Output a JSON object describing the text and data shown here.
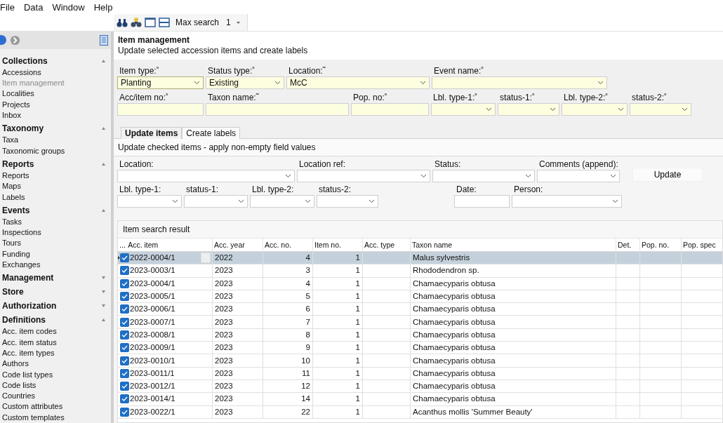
{
  "menu": [
    "File",
    "Data",
    "Window",
    "Help"
  ],
  "toolbar": {
    "max_search_label": "Max search",
    "max_search_value": "1"
  },
  "sidebar": [
    {
      "title": "Collections",
      "expanded": true,
      "items": [
        {
          "label": "Accessions",
          "selected": false
        },
        {
          "label": "Item management",
          "selected": true
        },
        {
          "label": "Localities",
          "selected": false
        },
        {
          "label": "Projects",
          "selected": false
        },
        {
          "label": "Inbox",
          "selected": false
        }
      ]
    },
    {
      "title": "Taxonomy",
      "expanded": true,
      "items": [
        {
          "label": "Taxa",
          "selected": false
        },
        {
          "label": "Taxonomic groups",
          "selected": false
        }
      ]
    },
    {
      "title": "Reports",
      "expanded": true,
      "items": [
        {
          "label": "Reports",
          "selected": false
        },
        {
          "label": "Maps",
          "selected": false
        },
        {
          "label": "Labels",
          "selected": false
        }
      ]
    },
    {
      "title": "Events",
      "expanded": true,
      "items": [
        {
          "label": "Tasks",
          "selected": false
        },
        {
          "label": "Inspections",
          "selected": false
        },
        {
          "label": "Tours",
          "selected": false
        },
        {
          "label": "Funding",
          "selected": false
        },
        {
          "label": "Exchanges",
          "selected": false
        }
      ]
    },
    {
      "title": "Management",
      "expanded": false
    },
    {
      "title": "Store",
      "expanded": false
    },
    {
      "title": "Authorization",
      "expanded": false
    },
    {
      "title": "Definitions",
      "expanded": true,
      "items": [
        {
          "label": "Acc. item codes",
          "selected": false
        },
        {
          "label": "Acc. item status",
          "selected": false
        },
        {
          "label": "Acc. item types",
          "selected": false
        },
        {
          "label": "Authors",
          "selected": false
        },
        {
          "label": "Code list types",
          "selected": false
        },
        {
          "label": "Code lists",
          "selected": false
        },
        {
          "label": "Countries",
          "selected": false
        },
        {
          "label": "Custom attributes",
          "selected": false
        },
        {
          "label": "Custom templates",
          "selected": false
        }
      ]
    }
  ],
  "page": {
    "title": "Item management",
    "subtitle": "Update selected accession items and create labels"
  },
  "filters": [
    {
      "fields": [
        {
          "label": "Item type:˚",
          "kind": "combo",
          "value": "Planting",
          "focused": true
        },
        {
          "label": "Status type:˚",
          "kind": "combo",
          "value": "Existing"
        },
        {
          "label": "Location:˜",
          "kind": "combo",
          "value": "McC"
        },
        {
          "label": "Event name:˚",
          "kind": "combo"
        }
      ]
    },
    {
      "fields": [
        {
          "label": "Acc/item no:˚",
          "kind": "text"
        },
        {
          "label": "Taxon name:˜",
          "kind": "text"
        },
        {
          "label": "Pop. no:˚",
          "kind": "text"
        },
        {
          "label": "Lbl. type-1:˚",
          "kind": "combo"
        },
        {
          "label": "status-1:˚",
          "kind": "combo"
        },
        {
          "label": "Lbl. type-2:˚",
          "kind": "combo"
        },
        {
          "label": "status-2:˚",
          "kind": "combo"
        }
      ]
    }
  ],
  "tabs": [
    {
      "label": "Update items",
      "selected": true
    },
    {
      "label": "Create labels",
      "selected": false
    }
  ],
  "update": {
    "description": "Update checked items - apply non-empty field values",
    "rows": [
      {
        "fields": [
          {
            "label": "Location:",
            "kind": "combo"
          },
          {
            "label": "Location ref:",
            "kind": "combo"
          },
          {
            "label": "Status:",
            "kind": "combo"
          },
          {
            "label": "Comments (append):",
            "kind": "combo"
          }
        ]
      },
      {
        "fields": [
          {
            "label": "Lbl. type-1:",
            "kind": "combo"
          },
          {
            "label": "status-1:",
            "kind": "combo"
          },
          {
            "label": "Lbl. type-2:",
            "kind": "combo"
          },
          {
            "label": "status-2:",
            "kind": "combo"
          },
          {
            "label": "Date:",
            "kind": "text"
          },
          {
            "label": "Person:",
            "kind": "combo"
          }
        ]
      }
    ],
    "button": "Update"
  },
  "table": {
    "title": "Item search result",
    "header_button": "...",
    "columns": [
      "Acc. item",
      "Acc. year",
      "Acc. no.",
      "Item no.",
      "Acc. type",
      "Taxon name",
      "Det.",
      "Pop. no.",
      "Pop. spec"
    ],
    "rows": [
      {
        "checked": true,
        "selected": true,
        "cells": [
          "2022-0004/1",
          "2022",
          "4",
          "1",
          "",
          "Malus sylvestris",
          "",
          "",
          ""
        ]
      },
      {
        "checked": true,
        "selected": false,
        "cells": [
          "2023-0003/1",
          "2023",
          "3",
          "1",
          "",
          "Rhododendron sp.",
          "",
          "",
          ""
        ]
      },
      {
        "checked": true,
        "selected": false,
        "cells": [
          "2023-0004/1",
          "2023",
          "4",
          "1",
          "",
          "Chamaecyparis obtusa",
          "",
          "",
          ""
        ]
      },
      {
        "checked": true,
        "selected": false,
        "cells": [
          "2023-0005/1",
          "2023",
          "5",
          "1",
          "",
          "Chamaecyparis obtusa",
          "",
          "",
          ""
        ]
      },
      {
        "checked": true,
        "selected": false,
        "cells": [
          "2023-0006/1",
          "2023",
          "6",
          "1",
          "",
          "Chamaecyparis obtusa",
          "",
          "",
          ""
        ]
      },
      {
        "checked": true,
        "selected": false,
        "cells": [
          "2023-0007/1",
          "2023",
          "7",
          "1",
          "",
          "Chamaecyparis obtusa",
          "",
          "",
          ""
        ]
      },
      {
        "checked": true,
        "selected": false,
        "cells": [
          "2023-0008/1",
          "2023",
          "8",
          "1",
          "",
          "Chamaecyparis obtusa",
          "",
          "",
          ""
        ]
      },
      {
        "checked": true,
        "selected": false,
        "cells": [
          "2023-0009/1",
          "2023",
          "9",
          "1",
          "",
          "Chamaecyparis obtusa",
          "",
          "",
          ""
        ]
      },
      {
        "checked": true,
        "selected": false,
        "cells": [
          "2023-0010/1",
          "2023",
          "10",
          "1",
          "",
          "Chamaecyparis obtusa",
          "",
          "",
          ""
        ]
      },
      {
        "checked": true,
        "selected": false,
        "cells": [
          "2023-0011/1",
          "2023",
          "11",
          "1",
          "",
          "Chamaecyparis obtusa",
          "",
          "",
          ""
        ]
      },
      {
        "checked": true,
        "selected": false,
        "cells": [
          "2023-0012/1",
          "2023",
          "12",
          "1",
          "",
          "Chamaecyparis obtusa",
          "",
          "",
          ""
        ]
      },
      {
        "checked": true,
        "selected": false,
        "cells": [
          "2023-0014/1",
          "2023",
          "14",
          "1",
          "",
          "Chamaecyparis obtusa",
          "",
          "",
          ""
        ]
      },
      {
        "checked": true,
        "selected": false,
        "cells": [
          "2023-0022/1",
          "2023",
          "22",
          "1",
          "",
          "Acanthus mollis 'Summer Beauty'",
          "",
          "",
          ""
        ]
      }
    ]
  }
}
